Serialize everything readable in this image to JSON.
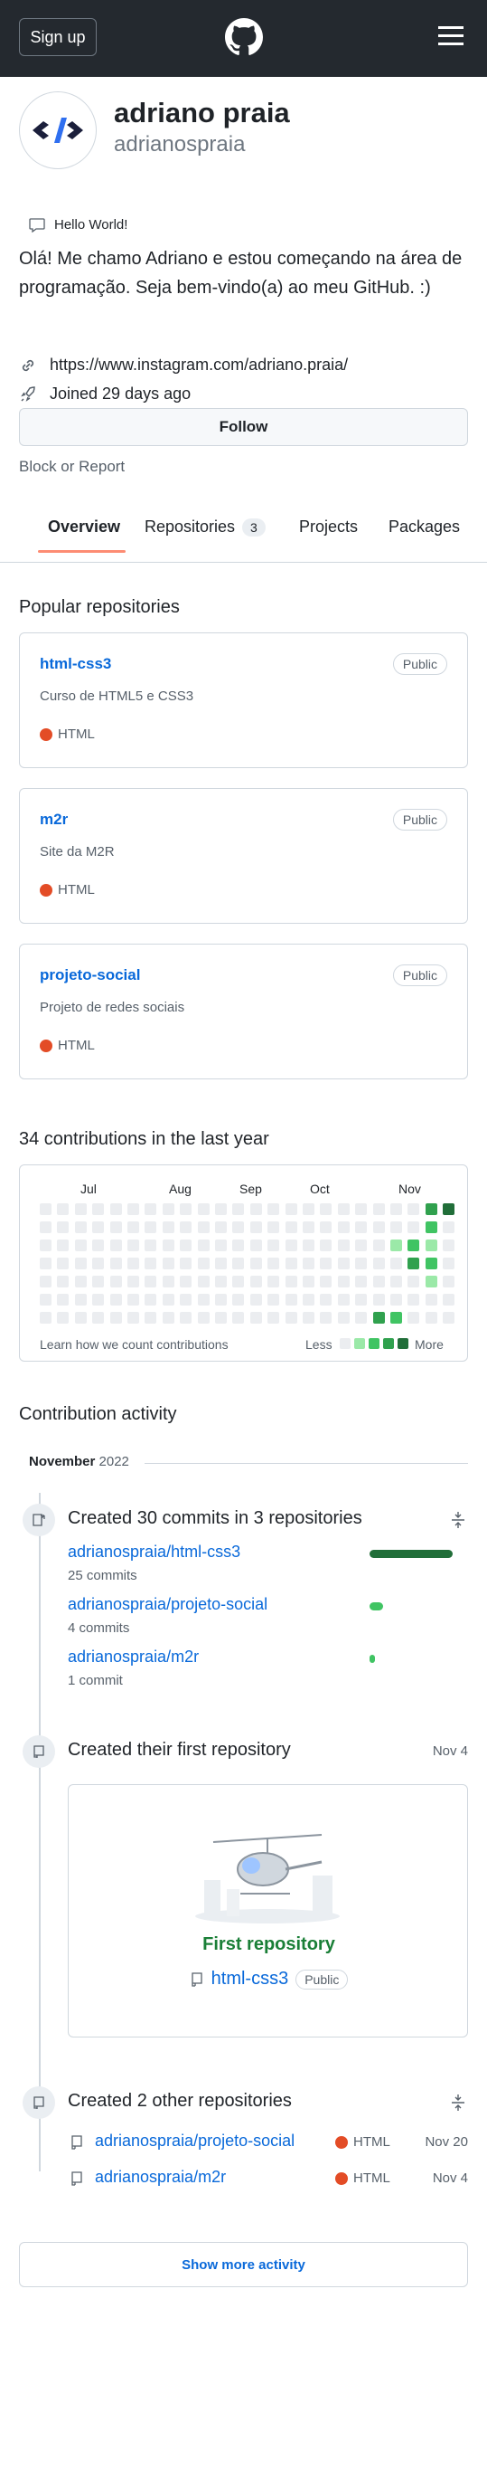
{
  "header": {
    "signup": "Sign up"
  },
  "profile": {
    "name": "adriano praia",
    "login": "adrianospraia",
    "status": "Hello World!",
    "bio": "Olá! Me chamo Adriano e estou começando na área de programação. Seja bem-vindo(a) ao meu GitHub. :)",
    "link": "https://www.instagram.com/adriano.praia/",
    "joined": "Joined 29 days ago",
    "follow": "Follow",
    "block": "Block or Report"
  },
  "tabs": {
    "overview": "Overview",
    "repositories": "Repositories",
    "repo_count": "3",
    "projects": "Projects",
    "packages": "Packages"
  },
  "popular": {
    "title": "Popular repositories",
    "repos": [
      {
        "name": "html-css3",
        "badge": "Public",
        "desc": "Curso de HTML5 e CSS3",
        "lang": "HTML"
      },
      {
        "name": "m2r",
        "badge": "Public",
        "desc": "Site da M2R",
        "lang": "HTML"
      },
      {
        "name": "projeto-social",
        "badge": "Public",
        "desc": "Projeto de redes sociais",
        "lang": "HTML"
      }
    ]
  },
  "contrib": {
    "title": "34 contributions in the last year",
    "months": [
      "Jul",
      "Aug",
      "Sep",
      "Oct",
      "Nov"
    ],
    "learn": "Learn how we count contributions",
    "less": "Less",
    "more": "More"
  },
  "activity": {
    "title": "Contribution activity",
    "month": "November",
    "year": "2022",
    "commits_title": "Created 30 commits in 3 repositories",
    "commits": [
      {
        "repo": "adrianospraia/html-css3",
        "count": "25 commits",
        "fraction": 1.0
      },
      {
        "repo": "adrianospraia/projeto-social",
        "count": "4 commits",
        "fraction": 0.16
      },
      {
        "repo": "adrianospraia/m2r",
        "count": "1 commit",
        "fraction": 0.04
      }
    ],
    "first_title": "Created their first repository",
    "first_date": "Nov 4",
    "first_label": "First repository",
    "first_repo": "html-css3",
    "first_badge": "Public",
    "other_title": "Created 2 other repositories",
    "others": [
      {
        "repo": "adrianospraia/projeto-social",
        "lang": "HTML",
        "date": "Nov 20"
      },
      {
        "repo": "adrianospraia/m2r",
        "lang": "HTML",
        "date": "Nov 4"
      }
    ],
    "show_more": "Show more activity"
  },
  "colors": {
    "accent": "#fd8c73",
    "link": "#0969da",
    "html": "#e34c26",
    "g1": "#9be9a8",
    "g2": "#40c463",
    "g3": "#30a14e",
    "g4": "#216e39",
    "empty": "#ebedf0"
  }
}
